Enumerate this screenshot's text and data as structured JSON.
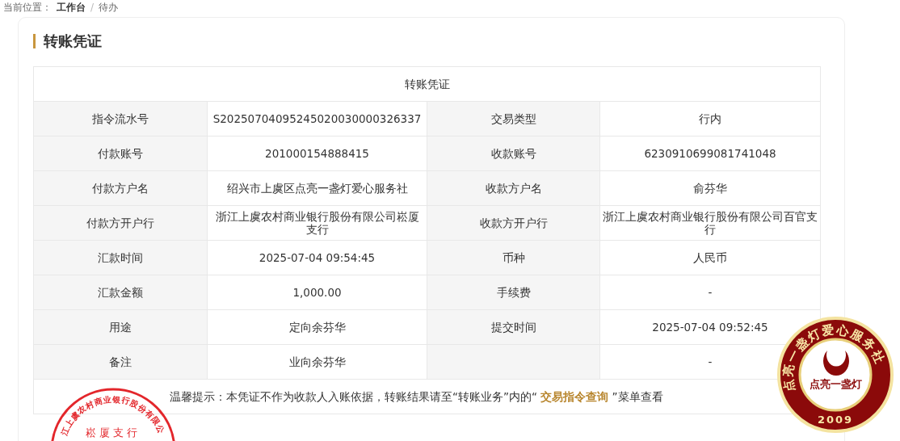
{
  "breadcrumb": {
    "label": "当前位置：",
    "items": [
      "工作台",
      "待办"
    ],
    "separator": "/"
  },
  "card": {
    "title": "转账凭证"
  },
  "voucher": {
    "title": "转账凭证",
    "rows": [
      [
        {
          "label": "指令流水号",
          "value": "S20250704095245020030000326337"
        },
        {
          "label": "交易类型",
          "value": "行内"
        }
      ],
      [
        {
          "label": "付款账号",
          "value": "201000154888415"
        },
        {
          "label": "收款账号",
          "value": "6230910699081741048"
        }
      ],
      [
        {
          "label": "付款方户名",
          "value": "绍兴市上虞区点亮一盏灯爱心服务社"
        },
        {
          "label": "收款方户名",
          "value": "俞芬华"
        }
      ],
      [
        {
          "label": "付款方开户行",
          "value": "浙江上虞农村商业银行股份有限公司崧厦支行"
        },
        {
          "label": "收款方开户行",
          "value": "浙江上虞农村商业银行股份有限公司百官支行"
        }
      ],
      [
        {
          "label": "汇款时间",
          "value": "2025-07-04 09:54:45"
        },
        {
          "label": "币种",
          "value": "人民币"
        }
      ],
      [
        {
          "label": "汇款金额",
          "value": "1,000.00"
        },
        {
          "label": "手续费",
          "value": "-"
        }
      ],
      [
        {
          "label": "用途",
          "value": "定向余芬华"
        },
        {
          "label": "提交时间",
          "value": "2025-07-04 09:52:45"
        }
      ],
      [
        {
          "label": "备注",
          "value": "业向余芬华"
        },
        {
          "value": "-"
        }
      ]
    ],
    "notice": {
      "before": "温馨提示：本凭证不作为收款人入账依据，转账结果请至“转账业务”内的“ ",
      "link": "交易指令查询",
      "after": " ”菜单查看"
    }
  },
  "seals": [
    {
      "kind": "bank",
      "ring_text": "江上虞农村商业银行股份有限公",
      "center_text": "崧厦支行"
    },
    {
      "kind": "emblem",
      "ring_text": "点亮一盏灯爱心服务社",
      "center_text": "点亮一盏灯",
      "year": "2009"
    }
  ]
}
